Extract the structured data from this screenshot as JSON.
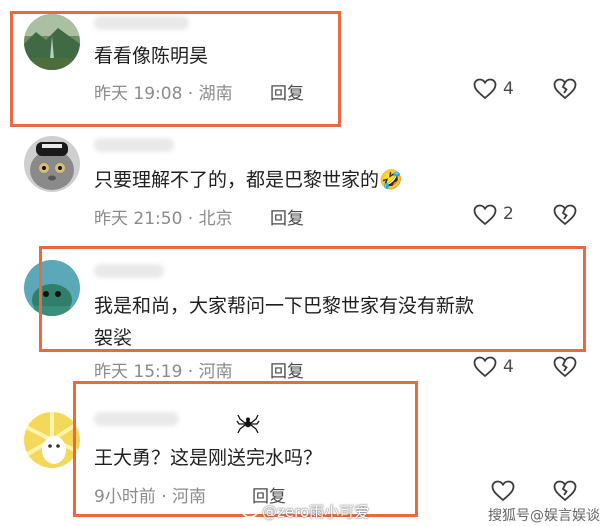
{
  "comments": [
    {
      "text": "看看像陈明昊",
      "meta": "昨天 19:08 · 湖南",
      "reply": "回复",
      "likes": "4",
      "avatar": "landscape-avatar-icon"
    },
    {
      "text": "只要理解不了的，都是巴黎世家的🤣",
      "meta": "昨天 21:50 · 北京",
      "reply": "回复",
      "likes": "2",
      "avatar": "cat-avatar-icon"
    },
    {
      "text": "我是和尚，大家帮问一下巴黎世家有没有新款\n袈裟",
      "meta": "昨天 15:19 · 河南",
      "reply": "回复",
      "likes": "4",
      "avatar": "cartoon-avatar-icon"
    },
    {
      "text": "王大勇？这是刚送完水吗？",
      "meta": "9小时前 · 河南",
      "reply": "回复",
      "likes": "",
      "avatar": "sunburst-avatar-icon"
    }
  ],
  "watermarks": {
    "weibo": "@zero雨小可爱",
    "sohu": "搜狐号@娱言娱谈"
  },
  "colors": {
    "highlight": "#ea6a3d",
    "meta_text": "#8b8b8b",
    "body_text": "#1f1f1f"
  }
}
